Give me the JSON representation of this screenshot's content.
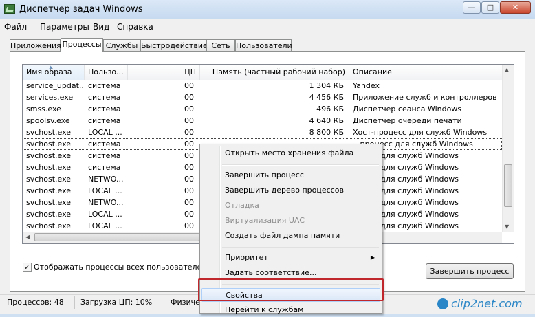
{
  "window": {
    "title": "Диспетчер задач Windows",
    "min_label": "—",
    "max_label": "□",
    "close_label": "✕"
  },
  "menu": [
    "Файл",
    "Параметры",
    "Вид",
    "Справка"
  ],
  "tabs": [
    "Приложения",
    "Процессы",
    "Службы",
    "Быстродействие",
    "Сеть",
    "Пользователи"
  ],
  "active_tab": "Процессы",
  "columns": [
    "Имя образа",
    "Пользо...",
    "ЦП",
    "Память (частный рабочий набор)",
    "Описание"
  ],
  "rows": [
    {
      "name": "service_updat...",
      "user": "система",
      "cpu": "00",
      "mem": "1 304 КБ",
      "desc": "Yandex"
    },
    {
      "name": "services.exe",
      "user": "система",
      "cpu": "00",
      "mem": "4 456 КБ",
      "desc": "Приложение служб и контроллеров"
    },
    {
      "name": "smss.exe",
      "user": "система",
      "cpu": "00",
      "mem": "496 КБ",
      "desc": "Диспетчер сеанса  Windows"
    },
    {
      "name": "spoolsv.exe",
      "user": "система",
      "cpu": "00",
      "mem": "4 640 КБ",
      "desc": "Диспетчер очереди печати"
    },
    {
      "name": "svchost.exe",
      "user": "LOCAL ...",
      "cpu": "00",
      "mem": "8 800 КБ",
      "desc": "Хост-процесс для служб Windows"
    },
    {
      "name": "svchost.exe",
      "user": "система",
      "cpu": "00",
      "mem": "",
      "desc": "...процесс для служб Windows"
    },
    {
      "name": "svchost.exe",
      "user": "система",
      "cpu": "00",
      "mem": "",
      "desc": "...цесс для служб Windows"
    },
    {
      "name": "svchost.exe",
      "user": "система",
      "cpu": "00",
      "mem": "",
      "desc": "...цесс для служб Windows"
    },
    {
      "name": "svchost.exe",
      "user": "NETWO...",
      "cpu": "00",
      "mem": "",
      "desc": "...цесс для служб Windows"
    },
    {
      "name": "svchost.exe",
      "user": "LOCAL ...",
      "cpu": "00",
      "mem": "",
      "desc": "...цесс для служб Windows"
    },
    {
      "name": "svchost.exe",
      "user": "NETWO...",
      "cpu": "00",
      "mem": "",
      "desc": "...цесс для служб Windows"
    },
    {
      "name": "svchost.exe",
      "user": "LOCAL ...",
      "cpu": "00",
      "mem": "",
      "desc": "...цесс для служб Windows"
    },
    {
      "name": "svchost.exe",
      "user": "LOCAL ...",
      "cpu": "00",
      "mem": "",
      "desc": "...цесс для служб Windows"
    },
    {
      "name": "svchost.exe",
      "user": "система",
      "cpu": "00",
      "mem": "",
      "desc": "...цесс для служб Windows"
    }
  ],
  "selected_row": 5,
  "show_all_users": {
    "checked": true,
    "label": "Отображать процессы всех пользователей",
    "check_glyph": "✓"
  },
  "end_process_button": "Завершить процесс",
  "status": {
    "processes": "Процессов: 48",
    "cpu": "Загрузка ЦП: 10%",
    "memory": "Физиче"
  },
  "context_menu": [
    {
      "label": "Открыть место хранения файла",
      "disabled": false
    },
    {
      "separator": true
    },
    {
      "label": "Завершить процесс",
      "disabled": false
    },
    {
      "label": "Завершить дерево процессов",
      "disabled": false
    },
    {
      "label": "Отладка",
      "disabled": true
    },
    {
      "label": "Виртуализация UAC",
      "disabled": true
    },
    {
      "label": "Создать файл дампа памяти",
      "disabled": false
    },
    {
      "separator": true
    },
    {
      "label": "Приоритет",
      "disabled": false,
      "submenu": true,
      "submenu_glyph": "▶"
    },
    {
      "label": "Задать соответствие...",
      "disabled": false
    },
    {
      "separator": true
    },
    {
      "label": "Свойства",
      "disabled": false,
      "hover": true
    },
    {
      "label": "Перейти к службам",
      "disabled": false
    }
  ],
  "watermark": "clip2net.com",
  "colors": {
    "highlight_border": "#c0272d",
    "title_bar": "#c5d9f0",
    "watermark": "#2a86c6"
  }
}
